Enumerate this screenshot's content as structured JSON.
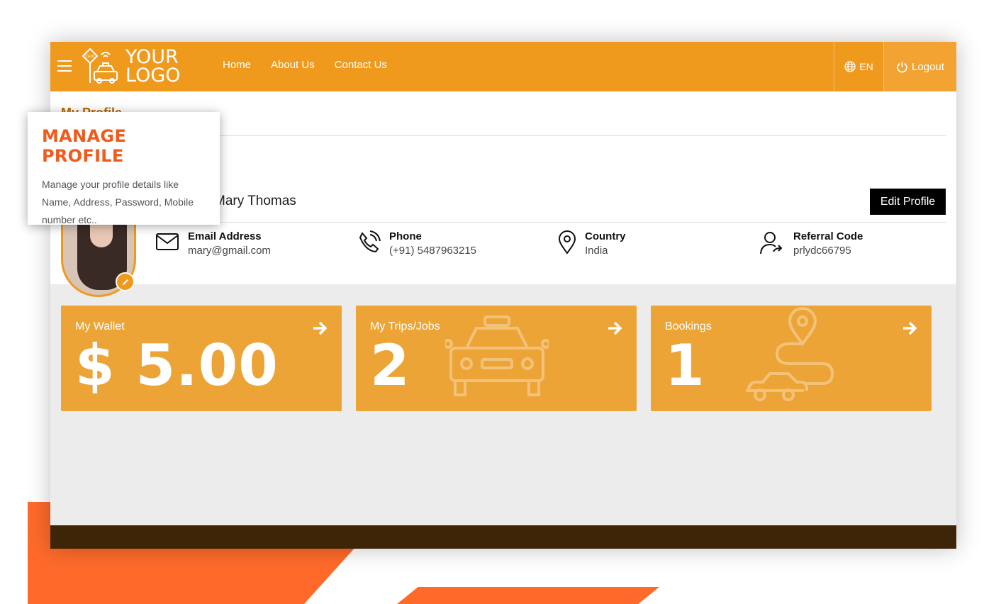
{
  "logo": {
    "line1": "YOUR",
    "line2": "LOGO",
    "badge": "TAXI"
  },
  "nav": {
    "items": [
      "Home",
      "About Us",
      "Contact Us"
    ]
  },
  "header": {
    "language": "EN",
    "logout": "Logout"
  },
  "profile": {
    "page_title": "My Profile",
    "name": "Mary Thomas",
    "edit_button": "Edit Profile",
    "email": {
      "label": "Email Address",
      "value": "mary@gmail.com"
    },
    "phone": {
      "label": "Phone",
      "value": "(+91) 5487963215"
    },
    "country": {
      "label": "Country",
      "value": "India"
    },
    "referral": {
      "label": "Referral Code",
      "value": "prlydc66795"
    }
  },
  "cards": [
    {
      "label": "My Wallet",
      "value": "$ 5.00"
    },
    {
      "label": "My Trips/Jobs",
      "value": "2"
    },
    {
      "label": "Bookings",
      "value": "1"
    }
  ],
  "tooltip": {
    "title": "MANAGE PROFILE",
    "body": "Manage your profile details like Name, Address, Password, Mobile number etc.."
  },
  "colors": {
    "primary": "#f09a1d",
    "card": "#eda436",
    "accent": "#f05a1a",
    "footer": "#3e2508"
  }
}
